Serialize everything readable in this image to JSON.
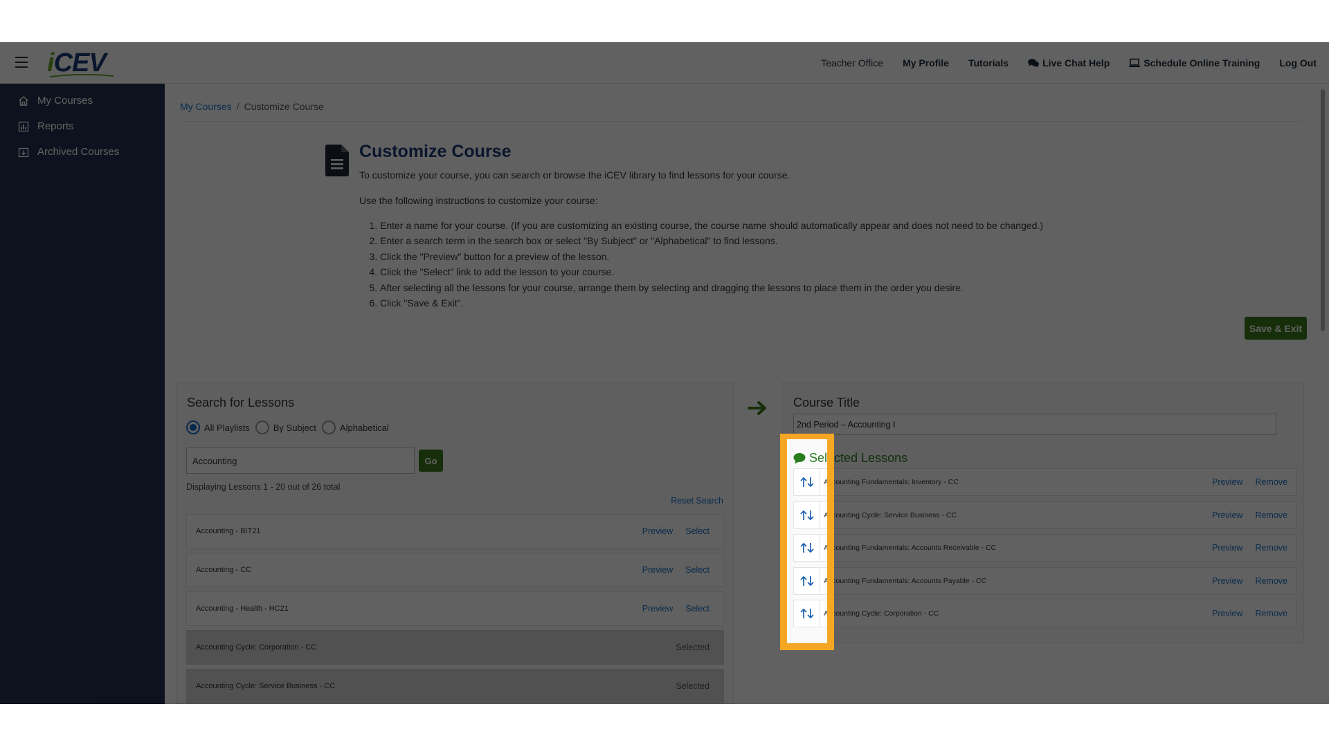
{
  "header": {
    "logo_text": "iCEV",
    "nav": [
      {
        "label": "Teacher Office",
        "icon": ""
      },
      {
        "label": "My Profile",
        "icon": ""
      },
      {
        "label": "Tutorials",
        "icon": ""
      },
      {
        "label": "Live Chat Help",
        "icon": "chat-bubbles-icon"
      },
      {
        "label": "Schedule Online Training",
        "icon": "laptop-icon"
      },
      {
        "label": "Log Out",
        "icon": ""
      }
    ]
  },
  "sidebar": {
    "items": [
      {
        "label": "My Courses",
        "icon": "home-icon"
      },
      {
        "label": "Reports",
        "icon": "chart-icon"
      },
      {
        "label": "Archived Courses",
        "icon": "archive-icon"
      }
    ]
  },
  "breadcrumb": {
    "root": "My Courses",
    "sep": "/",
    "current": "Customize Course"
  },
  "intro": {
    "title": "Customize Course",
    "description": "To customize your course, you can search or browse the iCEV library to find lessons for your course.",
    "instructions_heading": "Use the following instructions to customize your course:",
    "steps": [
      "Enter a name for your course. (If you are customizing an existing course, the course name should automatically appear and does not need to be changed.)",
      "Enter a search term in the search box or select \"By Subject\" or \"Alphabetical\" to find lessons.",
      "Click the \"Preview\" button for a preview of the lesson.",
      "Click the \"Select\" link to add the lesson to your course.",
      "After selecting all the lessons for your course, arrange them by selecting and dragging the lessons to place them in the order you desire.",
      "Click \"Save & Exit\"."
    ]
  },
  "save_button": "Save & Exit",
  "search": {
    "title": "Search for Lessons",
    "filters": [
      {
        "label": "All Playlists",
        "checked": true
      },
      {
        "label": "By Subject",
        "checked": false
      },
      {
        "label": "Alphabetical",
        "checked": false
      }
    ],
    "query": "Accounting",
    "go_label": "Go",
    "result_count": "Displaying Lessons 1 - 20 out of 26 total",
    "reset_label": "Reset Search",
    "results": [
      {
        "name": "Accounting - BIT21",
        "preview": "Preview",
        "select": "Select",
        "selected": false
      },
      {
        "name": "Accounting - CC",
        "preview": "Preview",
        "select": "Select",
        "selected": false
      },
      {
        "name": "Accounting - Health - HC21",
        "preview": "Preview",
        "select": "Select",
        "selected": false
      },
      {
        "name": "Accounting Cycle: Corporation - CC",
        "status": "Selected",
        "selected": true
      },
      {
        "name": "Accounting Cycle: Service Business - CC",
        "status": "Selected",
        "selected": true
      }
    ]
  },
  "course": {
    "title_label": "Course Title",
    "title_value": "2nd Period – Accounting I",
    "selected_label": "Selected Lessons",
    "selected": [
      {
        "name": "Accounting Fundamentals: Inventory - CC",
        "preview": "Preview",
        "remove": "Remove"
      },
      {
        "name": "Accounting Cycle: Service Business - CC",
        "preview": "Preview",
        "remove": "Remove"
      },
      {
        "name": "Accounting Fundamentals: Accounts Receivable - CC",
        "preview": "Preview",
        "remove": "Remove"
      },
      {
        "name": "Accounting Fundamentals: Accounts Payable - CC",
        "preview": "Preview",
        "remove": "Remove"
      },
      {
        "name": "Accounting Cycle: Corporation - CC",
        "preview": "Preview",
        "remove": "Remove"
      }
    ]
  },
  "colors": {
    "brand_navy": "#1b3a78",
    "sidebar": "#22344f",
    "accent_green": "#3c7a1a",
    "link_blue": "#1a73c9",
    "highlight": "#f5a623"
  }
}
